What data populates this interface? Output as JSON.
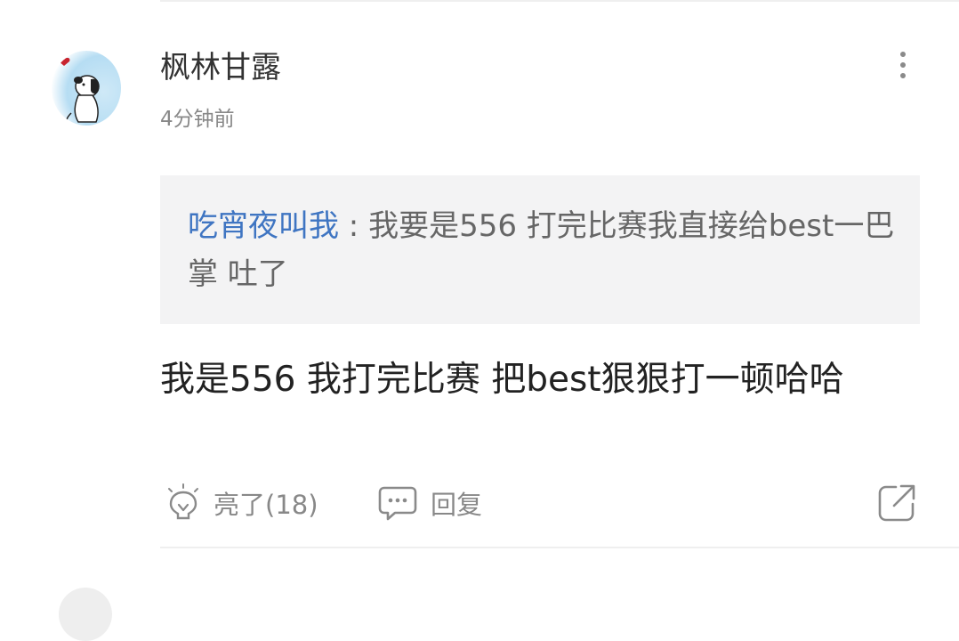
{
  "comment": {
    "username": "枫林甘露",
    "time": "4分钟前",
    "quote": {
      "author": "吃宵夜叫我",
      "separator": " : ",
      "text": "我要是556 打完比赛我直接给best一巴掌 吐了"
    },
    "text": "我是556 我打完比赛 把best狠狠打一顿哈哈",
    "actions": {
      "like_label": "亮了(18)",
      "reply_label": "回复"
    },
    "icons": {
      "more": "more-vertical-icon",
      "like": "lightbulb-icon",
      "reply": "chat-bubble-icon",
      "share": "share-icon"
    }
  },
  "colors": {
    "link": "#3f75c2",
    "quote_bg": "#f3f3f4",
    "muted": "#888888",
    "text": "#222222"
  }
}
